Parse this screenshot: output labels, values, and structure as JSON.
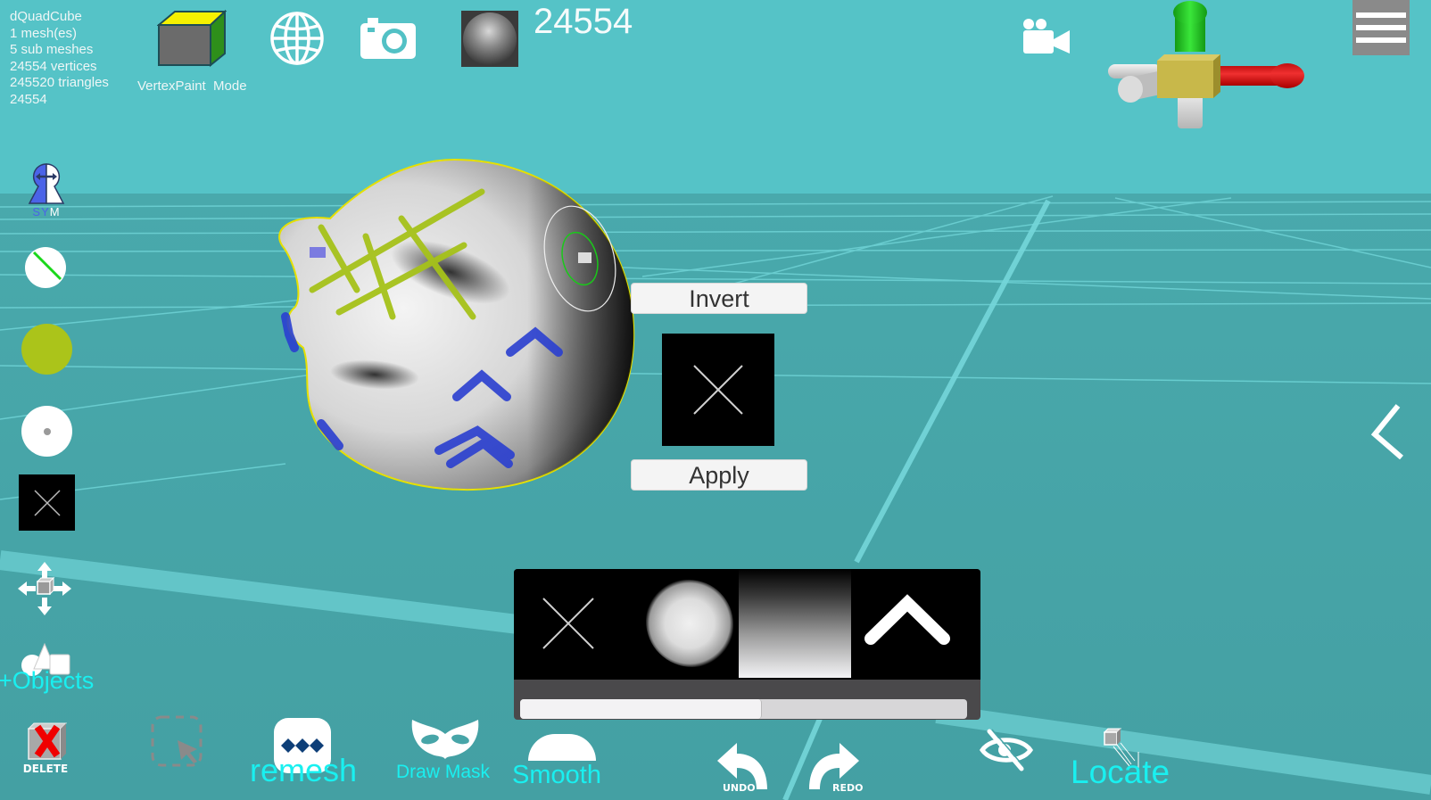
{
  "scene_info": {
    "object_name": "dQuadCube",
    "mesh_count": "1 mesh(es)",
    "sub_meshes": "5 sub meshes",
    "vertices": "24554 vertices",
    "triangles": "245520 triangles",
    "extra_value": "24554"
  },
  "top_bar": {
    "mode_label": "VertexPaint  Mode",
    "vertex_counter": "24554",
    "icons": [
      "cube-mode-icon",
      "globe-icon",
      "camera-icon",
      "material-sphere-icon",
      "video-camera-icon",
      "axis-gizmo",
      "hamburger-menu-icon"
    ]
  },
  "left_toolbar": {
    "symmetry_label_s": "S",
    "symmetry_label_y": "Y",
    "symmetry_label_m": "M",
    "paint_color": "#abc41a",
    "objects_label": "+Objects",
    "delete_label": "DELETE"
  },
  "popup": {
    "invert_label": "Invert",
    "apply_label": "Apply"
  },
  "brush_panel": {
    "brushes": [
      "cross-brush",
      "cloud-brush",
      "gradient-brush",
      "chevron-brush"
    ],
    "scroll_position": 0.54
  },
  "bottom_toolbar": {
    "remesh_label": "remesh",
    "draw_mask_label": "Draw Mask",
    "smooth_label": "Smooth",
    "undo_label": "UNDO",
    "redo_label": "REDO",
    "locate_label": "Locate"
  },
  "colors": {
    "sky": "#55c3c7",
    "floor": "#47a5a8",
    "accent_cyan": "#19f0f0",
    "x_axis": "#d81818",
    "y_axis": "#22c422",
    "gizmo_center": "#c8b84a",
    "mask_green": "#a6c21a",
    "paint_blue": "#2a3fd0"
  }
}
